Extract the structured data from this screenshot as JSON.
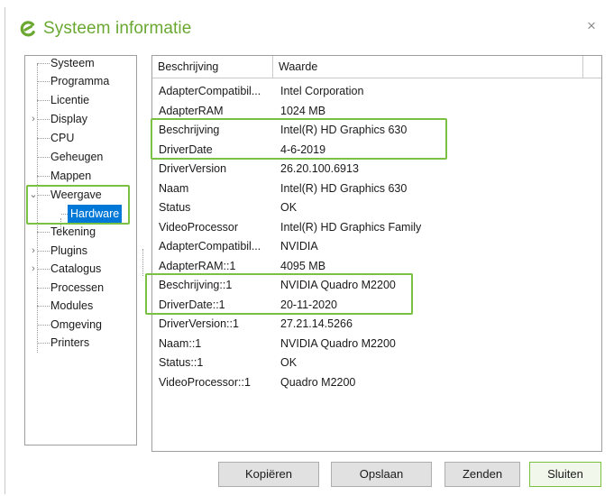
{
  "window": {
    "title": "Systeem informatie",
    "close_glyph": "×",
    "accent_color": "#6aa832",
    "highlight_color": "#7ac143"
  },
  "tree": {
    "items": [
      {
        "label": "Systeem",
        "expander": ""
      },
      {
        "label": "Programma",
        "expander": ""
      },
      {
        "label": "Licentie",
        "expander": ""
      },
      {
        "label": "Display",
        "expander": ">"
      },
      {
        "label": "CPU",
        "expander": ""
      },
      {
        "label": "Geheugen",
        "expander": ""
      },
      {
        "label": "Mappen",
        "expander": ""
      },
      {
        "label": "Weergave",
        "expander": "v"
      },
      {
        "label": "Hardware",
        "expander": "",
        "selected": true
      },
      {
        "label": "Tekening",
        "expander": ""
      },
      {
        "label": "Plugins",
        "expander": ">"
      },
      {
        "label": "Catalogus",
        "expander": ">"
      },
      {
        "label": "Processen",
        "expander": ""
      },
      {
        "label": "Modules",
        "expander": ""
      },
      {
        "label": "Omgeving",
        "expander": ""
      },
      {
        "label": "Printers",
        "expander": ""
      }
    ]
  },
  "grid": {
    "columns": [
      "Beschrijving",
      "Waarde"
    ],
    "rows": [
      [
        "AdapterCompatibil...",
        "Intel Corporation"
      ],
      [
        "AdapterRAM",
        "1024 MB"
      ],
      [
        "Beschrijving",
        "Intel(R) HD Graphics 630"
      ],
      [
        "DriverDate",
        "4-6-2019"
      ],
      [
        "DriverVersion",
        "26.20.100.6913"
      ],
      [
        "Naam",
        "Intel(R) HD Graphics 630"
      ],
      [
        "Status",
        "OK"
      ],
      [
        "VideoProcessor",
        "Intel(R) HD Graphics Family"
      ],
      [
        "AdapterCompatibil...",
        "NVIDIA"
      ],
      [
        "AdapterRAM::1",
        "4095 MB"
      ],
      [
        "Beschrijving::1",
        "NVIDIA Quadro M2200"
      ],
      [
        "DriverDate::1",
        "20-11-2020"
      ],
      [
        "DriverVersion::1",
        "27.21.14.5266"
      ],
      [
        "Naam::1",
        "NVIDIA Quadro M2200"
      ],
      [
        "Status::1",
        "OK"
      ],
      [
        "VideoProcessor::1",
        "Quadro M2200"
      ]
    ]
  },
  "buttons": {
    "copy": "Kopiëren",
    "save": "Opslaan",
    "send": "Zenden",
    "close": "Sluiten"
  }
}
